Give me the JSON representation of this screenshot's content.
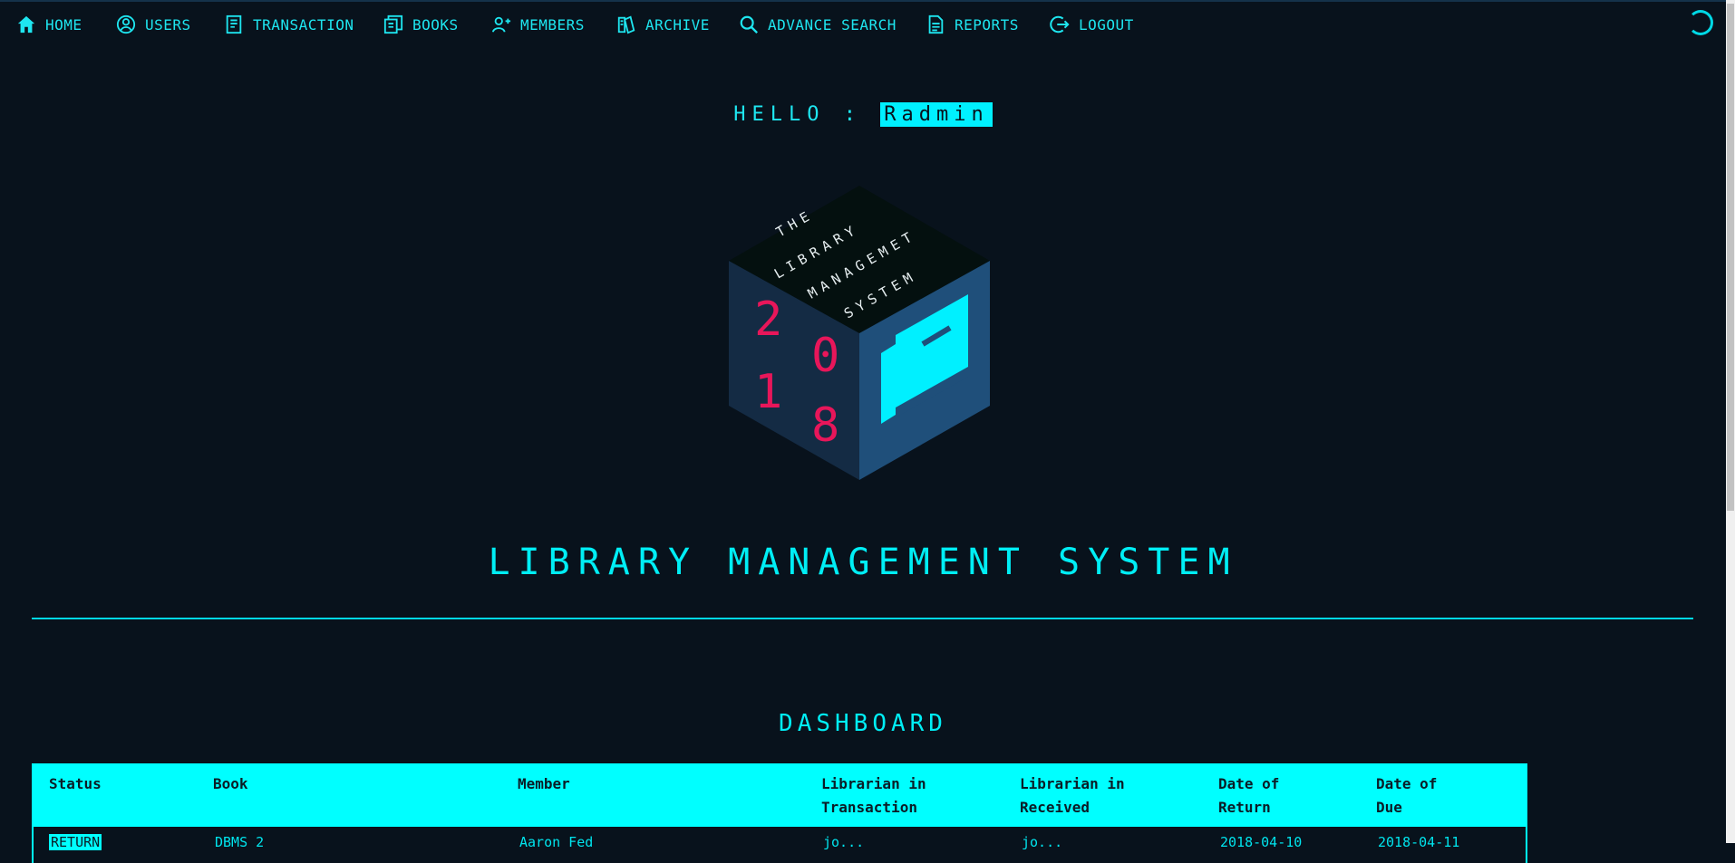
{
  "nav": {
    "items": [
      {
        "label": "HOME",
        "icon": "home-icon"
      },
      {
        "label": "USERS",
        "icon": "user-circle-icon"
      },
      {
        "label": "TRANSACTION",
        "icon": "receipt-icon"
      },
      {
        "label": "BOOKS",
        "icon": "books-icon"
      },
      {
        "label": "MEMBERS",
        "icon": "members-icon"
      },
      {
        "label": "ARCHIVE",
        "icon": "archive-icon"
      },
      {
        "label": "ADVANCE SEARCH",
        "icon": "search-icon"
      },
      {
        "label": "REPORTS",
        "icon": "report-icon"
      },
      {
        "label": "LOGOUT",
        "icon": "logout-icon"
      }
    ]
  },
  "greeting": {
    "prefix": "HELLO :",
    "username": "Radmin"
  },
  "logo": {
    "top_words": [
      "THE",
      "LIBRARY",
      "MANAGEMET",
      "SYSTEM"
    ],
    "year_digits": [
      "2",
      "0",
      "1",
      "8"
    ]
  },
  "app_title": "LIBRARY MANAGEMENT SYSTEM",
  "dashboard": {
    "title": "DASHBOARD",
    "columns": [
      "Status",
      "Book",
      "Member",
      "Librarian in\nTransaction",
      "Librarian in\nReceived",
      "Date of\nReturn",
      "Date of\nDue"
    ],
    "rows": [
      {
        "status": "RETURN",
        "book": "DBMS 2",
        "member": "Aaron Fed",
        "lib_transaction": "jo...",
        "lib_received": "jo...",
        "date_return": "2018-04-10",
        "date_due": "2018-04-11"
      }
    ]
  },
  "colors": {
    "accent": "#00ffff",
    "background": "#08121c",
    "logo_digits": "#e8165a",
    "logo_right_face": "#1f4f7a"
  }
}
